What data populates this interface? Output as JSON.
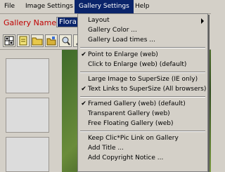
{
  "menubar": {
    "file": "File",
    "image_settings": "Image Settings",
    "gallery_settings": "Gallery Settings",
    "help": "Help"
  },
  "gallery": {
    "name_label": "Gallery Name:",
    "name_value": "Flora"
  },
  "colors": {
    "menu_highlight": "#0a246a",
    "label_red": "#c00000"
  },
  "menu": {
    "layout": "Layout",
    "gallery_color": "Gallery Color ...",
    "gallery_load_times": "Gallery Load times ...",
    "point_to_enlarge": "Point to Enlarge (web)",
    "click_to_enlarge": "Click to Enlarge (web)  (default)",
    "large_image_supersize": "Large Image to SuperSize (IE only)",
    "text_links_supersize": "Text Links to SuperSize (All browsers)",
    "framed_gallery": "Framed Gallery (web)  (default)",
    "transparent_gallery": "Transparent Gallery (web)",
    "free_floating_gallery": "Free Floating Gallery (web)",
    "keep_clicpic_link": "Keep Clic*Pic Link on Gallery",
    "add_title": "Add Title ...",
    "add_copyright": "Add Copyright Notice ...",
    "check_mark": "✔"
  },
  "toolbar_icons": [
    "grid-icon",
    "new-page-icon",
    "open-folder-icon",
    "save-icon",
    "image-icon",
    "tool-icon"
  ]
}
